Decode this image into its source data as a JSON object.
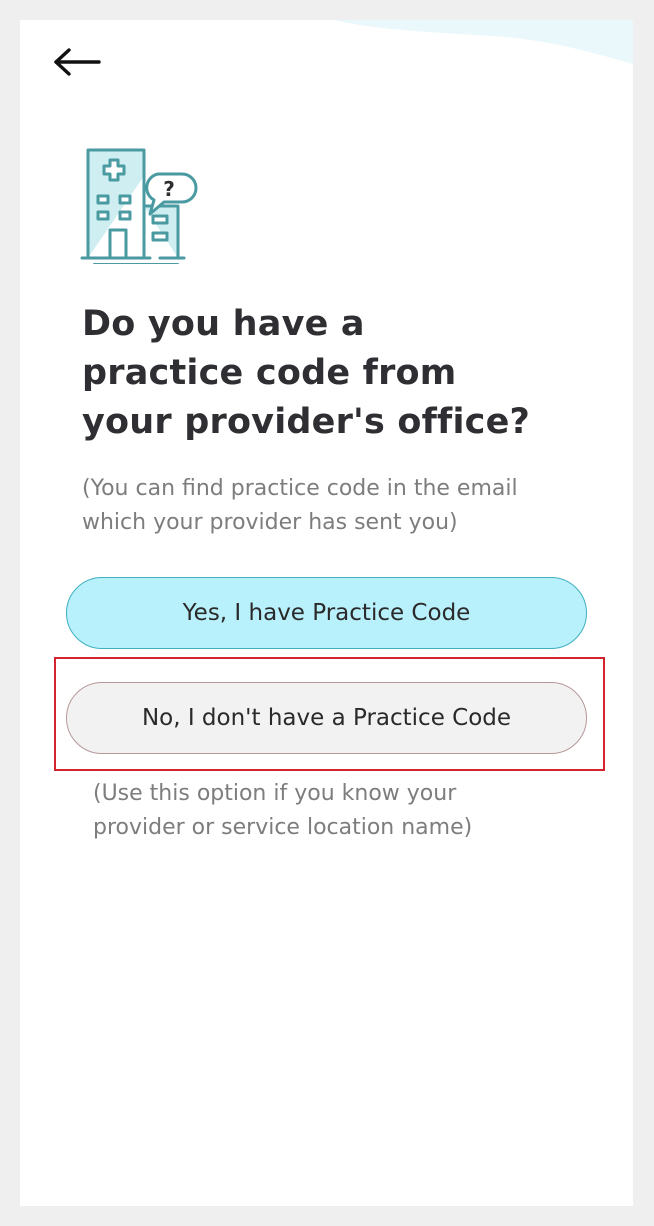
{
  "header": {
    "back_icon": "arrow-left-icon"
  },
  "illustration": {
    "icon": "hospital-building-question-icon",
    "glyph": "?",
    "color": "#4a9aa2"
  },
  "title": {
    "line1": "Do you have a",
    "line2": "practice code from",
    "line3": "your provider's office?"
  },
  "subtitle": {
    "line1": "(You can find practice code in the email",
    "line2": "which your provider has sent you)"
  },
  "options": {
    "yes_label": "Yes, I have Practice Code",
    "no_label": "No, I don't have a Practice Code"
  },
  "hint": {
    "line1": "(Use this option if you know your",
    "line2": "provider or service location name)"
  },
  "colors": {
    "primary_button": "#b8f0fc",
    "primary_border": "#3fb0c0",
    "secondary_button": "#f3f2f3",
    "highlight": "#d4242f",
    "wave": "#eaf8fc"
  }
}
